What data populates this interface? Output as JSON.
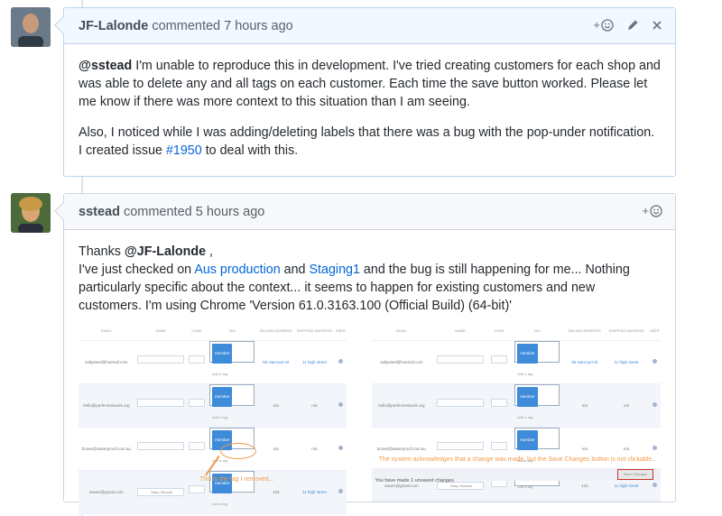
{
  "comments": [
    {
      "author": "JF-Lalonde",
      "meta": "commented 7 hours ago",
      "body": {
        "p1_mention": "@sstead",
        "p1_text": " I'm unable to reproduce this in development. I've tried creating customers for each shop and was able to delete any and all tags on each customer. Each time the save button worked. Please let me know if there was more context to this situation than I am seeing.",
        "p2_text_a": "Also, I noticed while I was adding/deleting labels that there was a bug with the pop-under notification. I created issue ",
        "p2_link": "#1950",
        "p2_text_b": " to deal with this."
      },
      "actions": {
        "react_plus": "+",
        "react_icon": "smiley-icon",
        "edit_icon": "pencil-icon",
        "close_icon": "x-icon"
      }
    },
    {
      "author": "sstead",
      "meta": "commented 5 hours ago",
      "body": {
        "l1_a": "Thanks ",
        "l1_mention": "@JF-Lalonde",
        "l1_b": " ,",
        "l2_a": "I've just checked on ",
        "l2_link1": "Aus production",
        "l2_b": " and ",
        "l2_link2": "Staging1",
        "l2_c": " and the bug is still happening for me... Nothing particularly specific about the context... it seems to happen for existing customers and new customers. I'm using Chrome 'Version 61.0.3163.100 (Official Build) (64-bit)'"
      },
      "actions": {
        "react_plus": "+",
        "react_icon": "smiley-icon"
      }
    }
  ],
  "screenshot_left": {
    "headers": [
      "EMAIL",
      "NAME",
      "CODE",
      "TAG",
      "BILLING ADDRESS",
      "SHIPPING ADDRESS",
      "USER"
    ],
    "rows": [
      {
        "email": "sallysteel@hotmail.com",
        "name": "Simone Steenstock",
        "tag": "member",
        "billing": "55 Harcourt St",
        "shipping": "11 high street"
      },
      {
        "email": "hello@perfectnetwork.org",
        "name": "",
        "tag": "member",
        "billing": "n/a",
        "shipping": "n/a"
      },
      {
        "email": "brown@waterproof.com.au",
        "name": "",
        "tag": "member",
        "billing": "n/a",
        "shipping": "n/a"
      },
      {
        "email": "sswes@gmail.com",
        "name": "Mary Stewart",
        "tag": "member",
        "billing": "123",
        "shipping": "11 high street"
      }
    ],
    "add_tag": "Add a tag",
    "annotation": "This is the tag I removed..."
  },
  "screenshot_right": {
    "headers": [
      "EMAIL",
      "NAME",
      "CODE",
      "TAG",
      "BILLING ADDRESS",
      "SHIPPING ADDRESS",
      "USER"
    ],
    "rows": [
      {
        "email": "sallysteel@hotmail.com",
        "name": "Simone Steenstock",
        "tag": "member",
        "billing": "55 Harcourt St",
        "shipping": "11 high street"
      },
      {
        "email": "hello@perfectnetwork.org",
        "name": "",
        "tag": "member",
        "billing": "n/a",
        "shipping": "n/a"
      },
      {
        "email": "brown@waterproof.com.au",
        "name": "",
        "tag": "member",
        "billing": "n/a",
        "shipping": "n/a"
      },
      {
        "email": "sswes@gmail.com",
        "name": "Mary Stewart",
        "tag": "",
        "billing": "123",
        "shipping": "11 high street"
      }
    ],
    "add_tag": "Add a tag",
    "annotation": "The system acknowledges that a change was made, but the Save Changes button is not clickable...",
    "unsaved": "You have made 1 unsaved changes",
    "save_label": "Save Changes"
  }
}
